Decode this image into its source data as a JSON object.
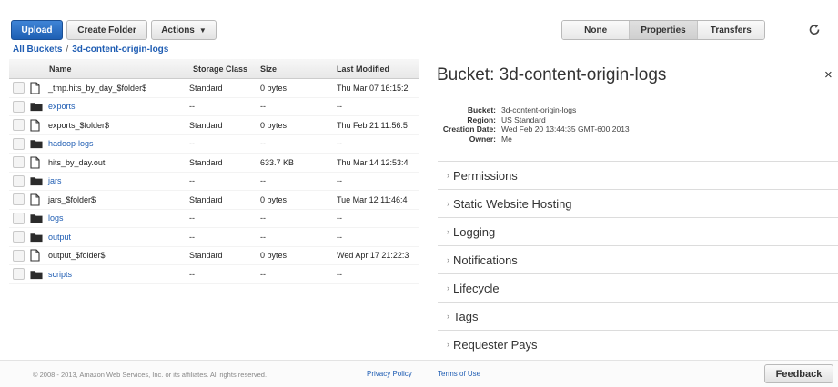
{
  "toolbar": {
    "upload_label": "Upload",
    "create_folder_label": "Create Folder",
    "actions_label": "Actions",
    "view_toggle": [
      "None",
      "Properties",
      "Transfers"
    ],
    "active_view": "Properties"
  },
  "breadcrumb": {
    "root": "All Buckets",
    "separator": "/",
    "current": "3d-content-origin-logs"
  },
  "table": {
    "columns": [
      "Name",
      "Storage Class",
      "Size",
      "Last Modified"
    ],
    "rows": [
      {
        "type": "file",
        "name": "_tmp.hits_by_day_$folder$",
        "storage_class": "Standard",
        "size": "0 bytes",
        "modified": "Thu Mar 07 16:15:2"
      },
      {
        "type": "folder",
        "name": "exports",
        "storage_class": "--",
        "size": "--",
        "modified": "--"
      },
      {
        "type": "file",
        "name": "exports_$folder$",
        "storage_class": "Standard",
        "size": "0 bytes",
        "modified": "Thu Feb 21 11:56:5"
      },
      {
        "type": "folder",
        "name": "hadoop-logs",
        "storage_class": "--",
        "size": "--",
        "modified": "--"
      },
      {
        "type": "file",
        "name": "hits_by_day.out",
        "storage_class": "Standard",
        "size": "633.7 KB",
        "modified": "Thu Mar 14 12:53:4"
      },
      {
        "type": "folder",
        "name": "jars",
        "storage_class": "--",
        "size": "--",
        "modified": "--"
      },
      {
        "type": "file",
        "name": "jars_$folder$",
        "storage_class": "Standard",
        "size": "0 bytes",
        "modified": "Tue Mar 12 11:46:4"
      },
      {
        "type": "folder",
        "name": "logs",
        "storage_class": "--",
        "size": "--",
        "modified": "--"
      },
      {
        "type": "folder",
        "name": "output",
        "storage_class": "--",
        "size": "--",
        "modified": "--"
      },
      {
        "type": "file",
        "name": "output_$folder$",
        "storage_class": "Standard",
        "size": "0 bytes",
        "modified": "Wed Apr 17 21:22:3"
      },
      {
        "type": "folder",
        "name": "scripts",
        "storage_class": "--",
        "size": "--",
        "modified": "--"
      }
    ]
  },
  "panel": {
    "title": "Bucket: 3d-content-origin-logs",
    "close_glyph": "×",
    "info": [
      {
        "key": "Bucket:",
        "value": "3d-content-origin-logs"
      },
      {
        "key": "Region:",
        "value": "US Standard"
      },
      {
        "key": "Creation Date:",
        "value": "Wed Feb 20 13:44:35 GMT-600 2013"
      },
      {
        "key": "Owner:",
        "value": "Me"
      }
    ],
    "sections": [
      "Permissions",
      "Static Website Hosting",
      "Logging",
      "Notifications",
      "Lifecycle",
      "Tags",
      "Requester Pays"
    ]
  },
  "footer": {
    "copyright": "© 2008 - 2013, Amazon Web Services, Inc. or its affiliates. All rights reserved.",
    "privacy_label": "Privacy Policy",
    "terms_label": "Terms of Use",
    "feedback_label": "Feedback"
  },
  "colors": {
    "accent": "#1f5db3",
    "primary_button": "#2a6cc4"
  }
}
